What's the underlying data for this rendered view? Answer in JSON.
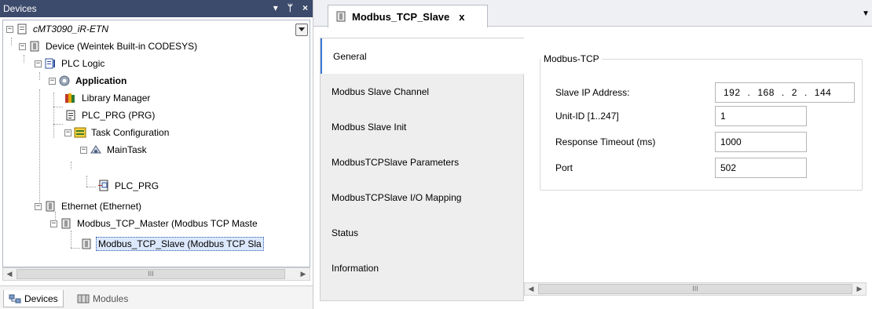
{
  "devices_pane": {
    "title": "Devices",
    "controls": {
      "dropdown": "▾",
      "pin": "ᛘ",
      "close": "×"
    },
    "tree": [
      {
        "label": "cMT3090_iR-ETN",
        "icon": "project-icon"
      },
      {
        "label": "Device (Weintek Built-in CODESYS)",
        "icon": "device-icon"
      },
      {
        "label": "PLC Logic",
        "icon": "plc-logic-icon"
      },
      {
        "label": "Application",
        "icon": "application-gear-icon"
      },
      {
        "label": "Library Manager",
        "icon": "library-books-icon"
      },
      {
        "label": "PLC_PRG (PRG)",
        "icon": "pou-icon"
      },
      {
        "label": "Task Configuration",
        "icon": "task-config-icon"
      },
      {
        "label": "MainTask",
        "icon": "task-icon"
      },
      {
        "label": "PLC_PRG",
        "icon": "program-call-icon"
      },
      {
        "label": "Ethernet (Ethernet)",
        "icon": "device-icon"
      },
      {
        "label": "Modbus_TCP_Master (Modbus TCP Maste",
        "icon": "device-icon"
      },
      {
        "label": "Modbus_TCP_Slave (Modbus TCP Sla",
        "icon": "device-icon"
      }
    ],
    "bottom_tabs": [
      {
        "label": "Devices",
        "icon": "devices-icon"
      },
      {
        "label": "Modules",
        "icon": "modules-icon"
      }
    ],
    "scroll_thumb_grip": "III"
  },
  "editor": {
    "tab_title": "Modbus_TCP_Slave",
    "tab_close": "x",
    "nav": [
      "General",
      "Modbus Slave Channel",
      "Modbus Slave Init",
      "ModbusTCPSlave Parameters",
      "ModbusTCPSlave I/O Mapping",
      "Status",
      "Information"
    ],
    "group_title": "Modbus-TCP",
    "fields": [
      {
        "label": "Slave IP Address:",
        "value": [
          "192",
          "168",
          "2",
          "144"
        ]
      },
      {
        "label": "Unit-ID [1..247]",
        "value": "1"
      },
      {
        "label": "Response Timeout (ms)",
        "value": "1000"
      },
      {
        "label": "Port",
        "value": "502"
      }
    ],
    "scroll_thumb_grip": "III"
  }
}
